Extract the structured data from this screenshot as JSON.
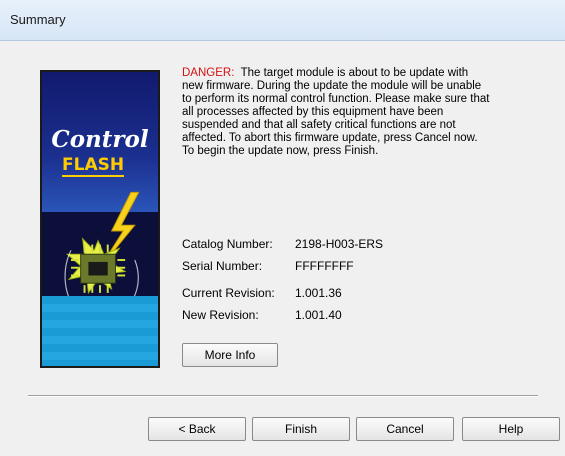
{
  "window": {
    "title": "Summary"
  },
  "logo": {
    "line1": "Control",
    "line2": "FLASH"
  },
  "message": {
    "danger_label": "DANGER:",
    "body": "The target module is about to be update with new firmware. During the update the module will be unable to perform its normal control function. Please make sure that all processes affected by this equipment have been suspended and that all safety critical functions are not affected. To abort this firmware update, press Cancel now. To begin the update now, press Finish."
  },
  "info": {
    "catalog_label": "Catalog Number:",
    "catalog_value": "2198-H003-ERS",
    "serial_label": "Serial Number:",
    "serial_value": "FFFFFFFF",
    "current_label": "Current Revision:",
    "current_value": "1.001.36",
    "new_label": "New Revision:",
    "new_value": "1.001.40"
  },
  "buttons": {
    "more_info": "More Info",
    "back": "< Back",
    "finish": "Finish",
    "cancel": "Cancel",
    "help": "Help"
  }
}
